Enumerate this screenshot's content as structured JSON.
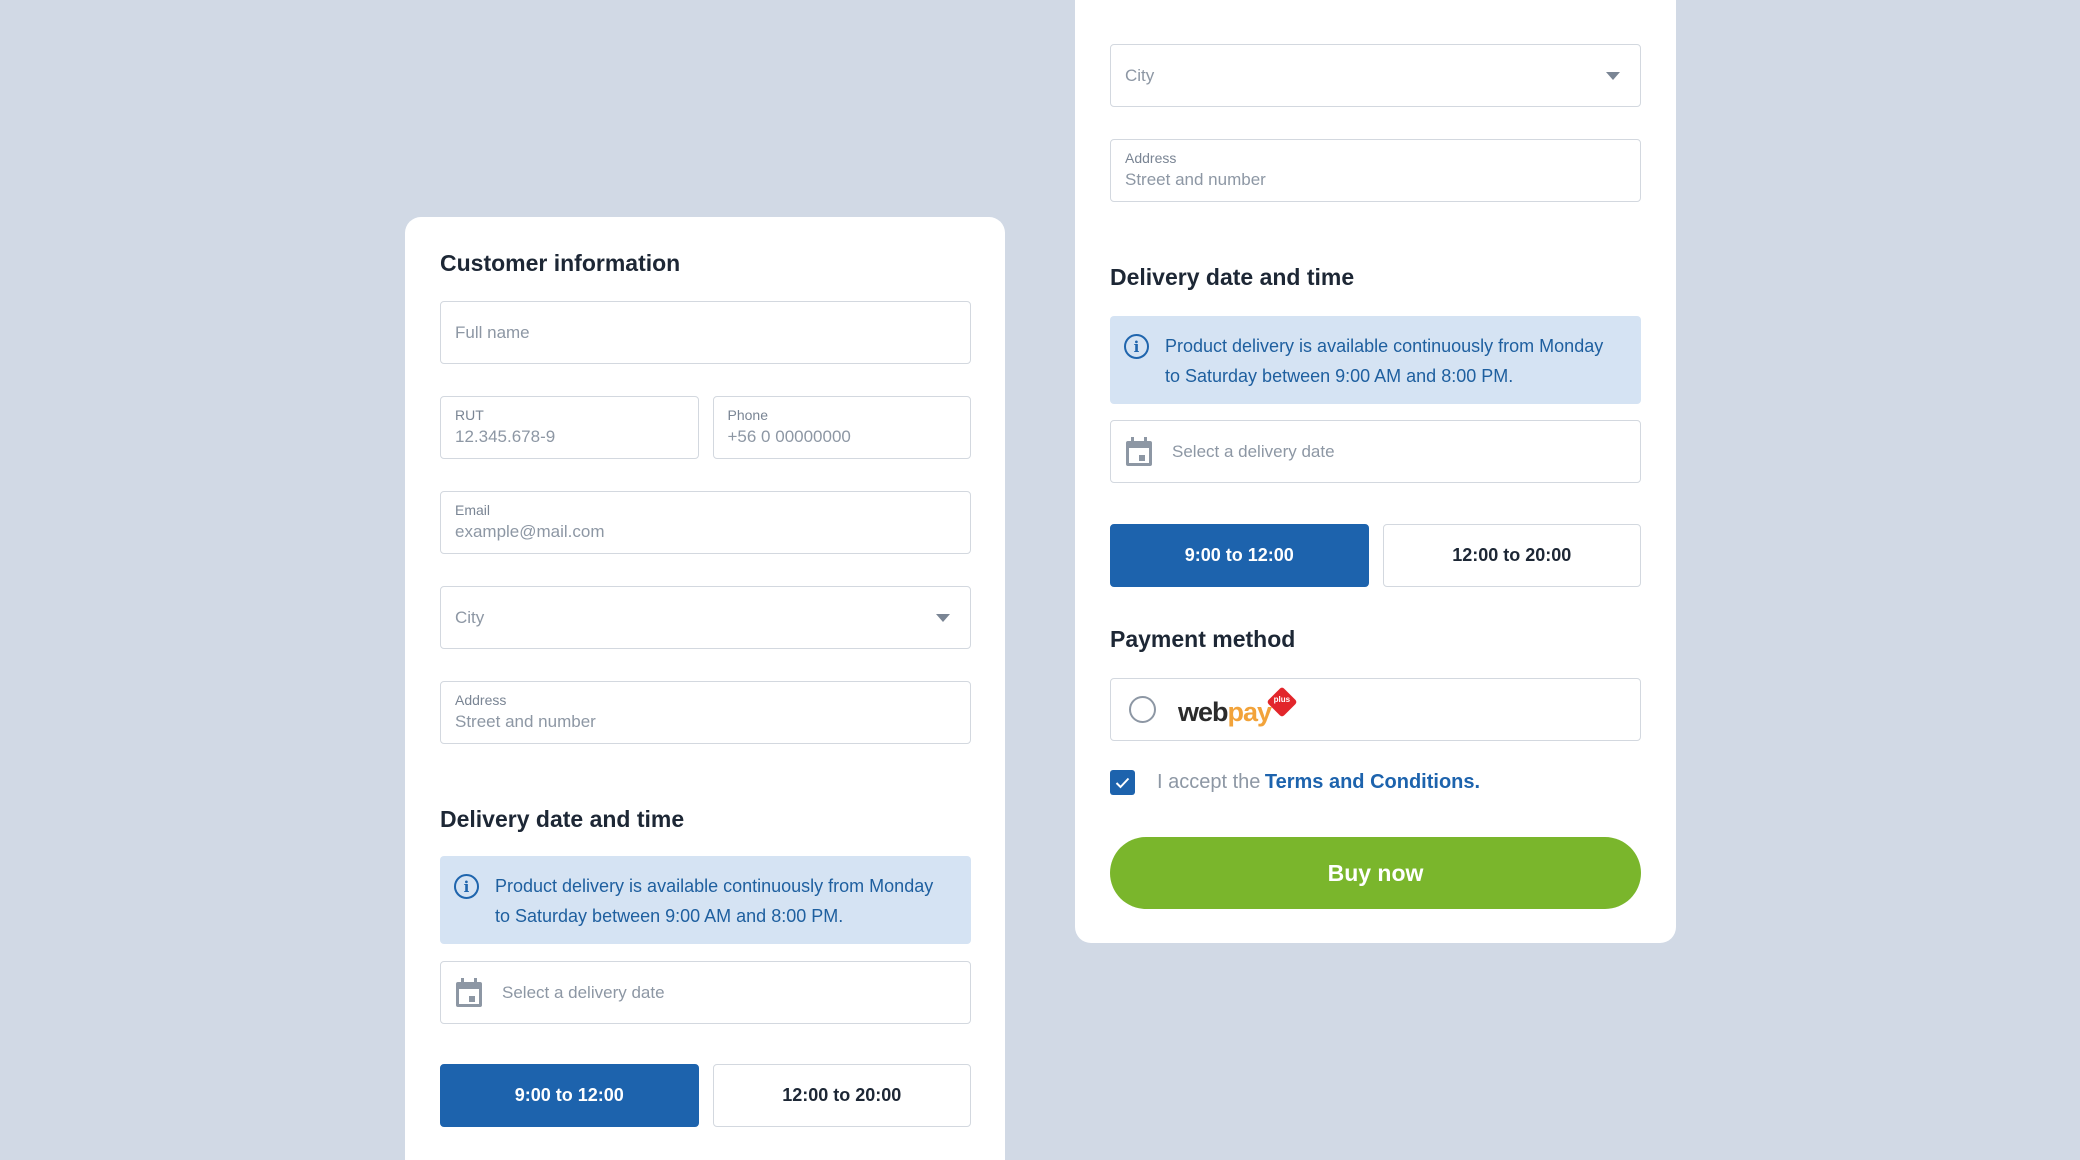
{
  "customer": {
    "title": "Customer information",
    "fullname_placeholder": "Full name",
    "rut_label": "RUT",
    "rut_placeholder": "12.345.678-9",
    "phone_label": "Phone",
    "phone_placeholder": "+56 0 00000000",
    "email_label": "Email",
    "email_placeholder": "example@mail.com",
    "city_placeholder": "City",
    "address_label": "Address",
    "address_placeholder": "Street and number"
  },
  "delivery": {
    "title": "Delivery date and time",
    "info_line1": "Product delivery is available continuously from Monday",
    "info_line2": "to Saturday between 9:00 AM and 8:00 PM.",
    "date_placeholder": "Select a delivery date",
    "slots": [
      {
        "label": "9:00 to 12:00",
        "selected": true
      },
      {
        "label": "12:00 to 20:00",
        "selected": false
      }
    ]
  },
  "payment": {
    "title": "Payment method",
    "provider_part1": "web",
    "provider_part2": "pay",
    "provider_badge": "plus",
    "terms_prefix": "I accept the",
    "terms_link": "Terms and Conditions.",
    "terms_checked": true,
    "buy_label": "Buy now"
  },
  "colors": {
    "background": "#d1d9e5",
    "primary": "#1d63ad",
    "buy": "#7ab62c",
    "info_bg": "#d5e3f3"
  }
}
